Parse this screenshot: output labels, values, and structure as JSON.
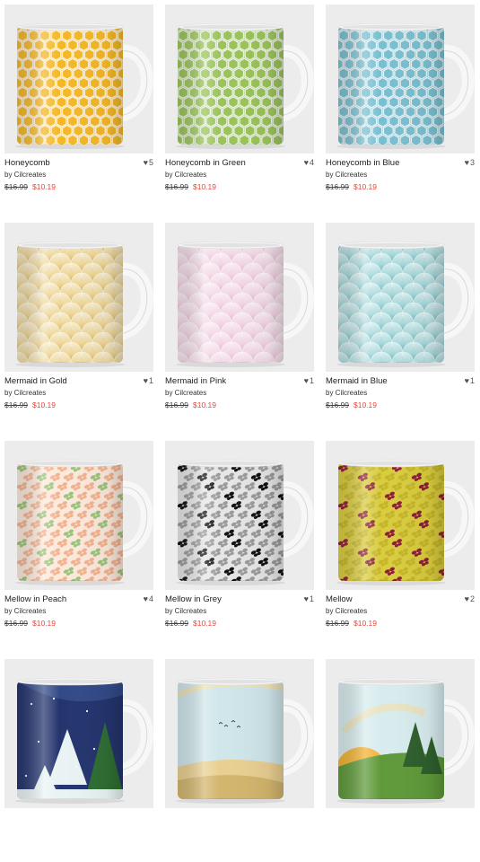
{
  "products": [
    {
      "title": "Honeycomb",
      "by": "by Cilcreates",
      "likes": "5",
      "old_price": "$16.99",
      "price": "$10.19",
      "pattern": "honeycomb",
      "colors": [
        "#f4b826",
        "#e89a10"
      ]
    },
    {
      "title": "Honeycomb in Green",
      "by": "by Cilcreates",
      "likes": "4",
      "old_price": "$16.99",
      "price": "$10.19",
      "pattern": "honeycomb",
      "colors": [
        "#9ac45a",
        "#6e9a36"
      ]
    },
    {
      "title": "Honeycomb in Blue",
      "by": "by Cilcreates",
      "likes": "3",
      "old_price": "$16.99",
      "price": "$10.19",
      "pattern": "honeycomb",
      "colors": [
        "#79bfd0",
        "#3f8ea4"
      ]
    },
    {
      "title": "Mermaid in Gold",
      "by": "by Cilcreates",
      "likes": "1",
      "old_price": "$16.99",
      "price": "$10.19",
      "pattern": "scales",
      "colors": [
        "#f0d796",
        "#c9a94e"
      ]
    },
    {
      "title": "Mermaid in Pink",
      "by": "by Cilcreates",
      "likes": "1",
      "old_price": "$16.99",
      "price": "$10.19",
      "pattern": "scales",
      "colors": [
        "#f4d6e6",
        "#d9aec4"
      ]
    },
    {
      "title": "Mermaid in Blue",
      "by": "by Cilcreates",
      "likes": "1",
      "old_price": "$16.99",
      "price": "$10.19",
      "pattern": "scales",
      "colors": [
        "#a8dadd",
        "#5fa6ac"
      ]
    },
    {
      "title": "Mellow in Peach",
      "by": "by Cilcreates",
      "likes": "4",
      "old_price": "$16.99",
      "price": "$10.19",
      "pattern": "mellow",
      "colors": [
        "#fbe9dc",
        "#f3b28f",
        "#9bc47a"
      ]
    },
    {
      "title": "Mellow in Grey",
      "by": "by Cilcreates",
      "likes": "1",
      "old_price": "$16.99",
      "price": "$10.19",
      "pattern": "mellow",
      "colors": [
        "#e6e6e6",
        "#9a9a9a",
        "#111111"
      ]
    },
    {
      "title": "Mellow",
      "by": "by Cilcreates",
      "likes": "2",
      "old_price": "$16.99",
      "price": "$10.19",
      "pattern": "mellow",
      "colors": [
        "#d9cc3e",
        "#c5b52a",
        "#8e1e3a"
      ]
    },
    {
      "title": "",
      "by": "",
      "likes": "",
      "old_price": "",
      "price": "",
      "pattern": "night",
      "colors": [
        "#24346e",
        "#e9f3f4",
        "#2f6e33"
      ]
    },
    {
      "title": "",
      "by": "",
      "likes": "",
      "old_price": "",
      "price": "",
      "pattern": "desert",
      "colors": [
        "#cfe6ea",
        "#e9cf91",
        "#d3b56d"
      ]
    },
    {
      "title": "",
      "by": "",
      "likes": "",
      "old_price": "",
      "price": "",
      "pattern": "sunrise",
      "colors": [
        "#d8ecee",
        "#f2b233",
        "#5f9a3a"
      ]
    }
  ]
}
